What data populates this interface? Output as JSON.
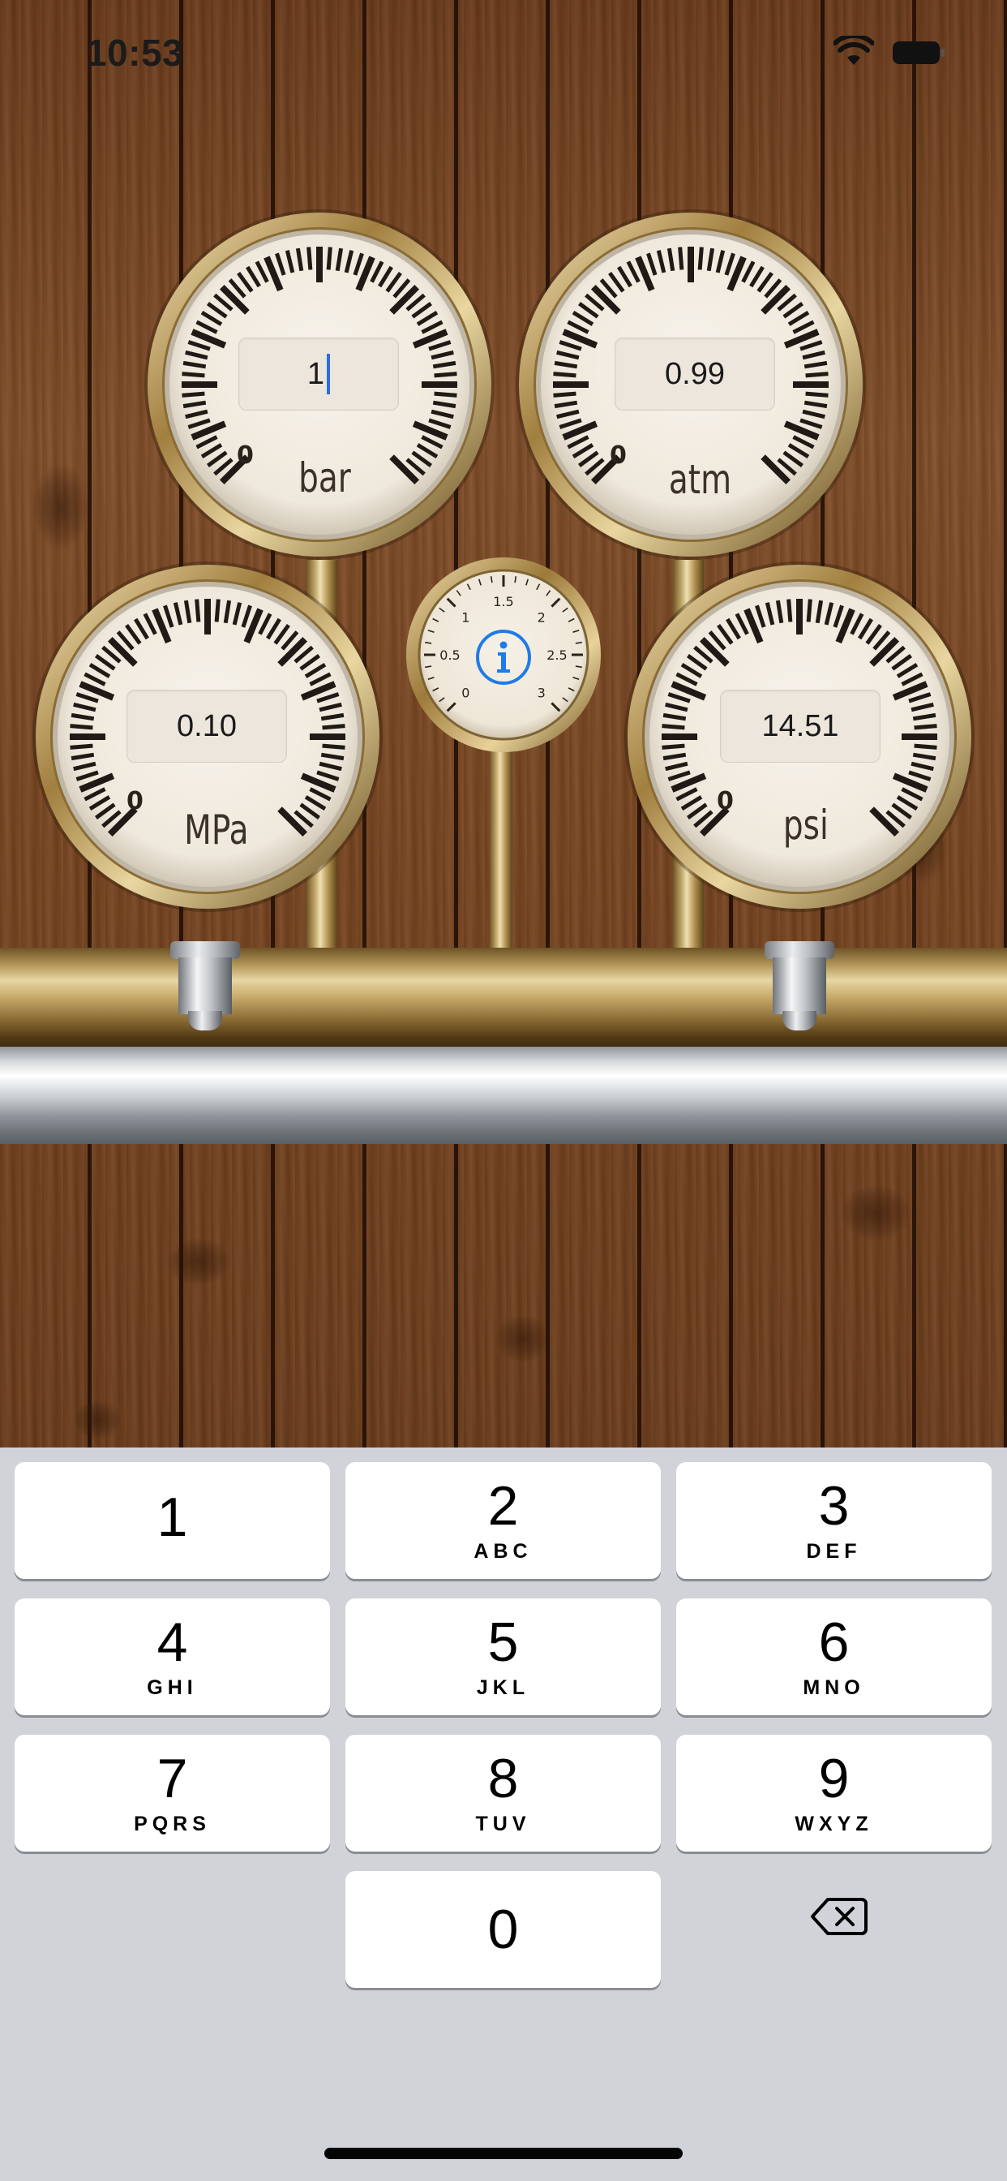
{
  "status_bar": {
    "time": "10:53"
  },
  "gauges": {
    "bar": {
      "value": "1",
      "unit": "bar",
      "zero": "0",
      "focused": true
    },
    "atm": {
      "value": "0.99",
      "unit": "atm",
      "zero": "0"
    },
    "mpa": {
      "value": "0.10",
      "unit": "MPa",
      "zero": "0"
    },
    "psi": {
      "value": "14.51",
      "unit": "psi",
      "zero": "0"
    }
  },
  "info_gauge": {
    "icon": "info-icon",
    "scale_labels": [
      "0",
      "0.5",
      "1",
      "1.5",
      "2",
      "2.5",
      "3"
    ]
  },
  "keypad": {
    "keys": [
      {
        "num": "1",
        "letters": ""
      },
      {
        "num": "2",
        "letters": "ABC"
      },
      {
        "num": "3",
        "letters": "DEF"
      },
      {
        "num": "4",
        "letters": "GHI"
      },
      {
        "num": "5",
        "letters": "JKL"
      },
      {
        "num": "6",
        "letters": "MNO"
      },
      {
        "num": "7",
        "letters": "PQRS"
      },
      {
        "num": "8",
        "letters": "TUV"
      },
      {
        "num": "9",
        "letters": "WXYZ"
      },
      {
        "num": "0",
        "letters": ""
      }
    ],
    "delete_icon": "backspace-icon"
  },
  "colors": {
    "cursor": "#2f6ce0",
    "info_blue": "#1e7be8",
    "keyboard_bg": "#d1d3d9"
  }
}
